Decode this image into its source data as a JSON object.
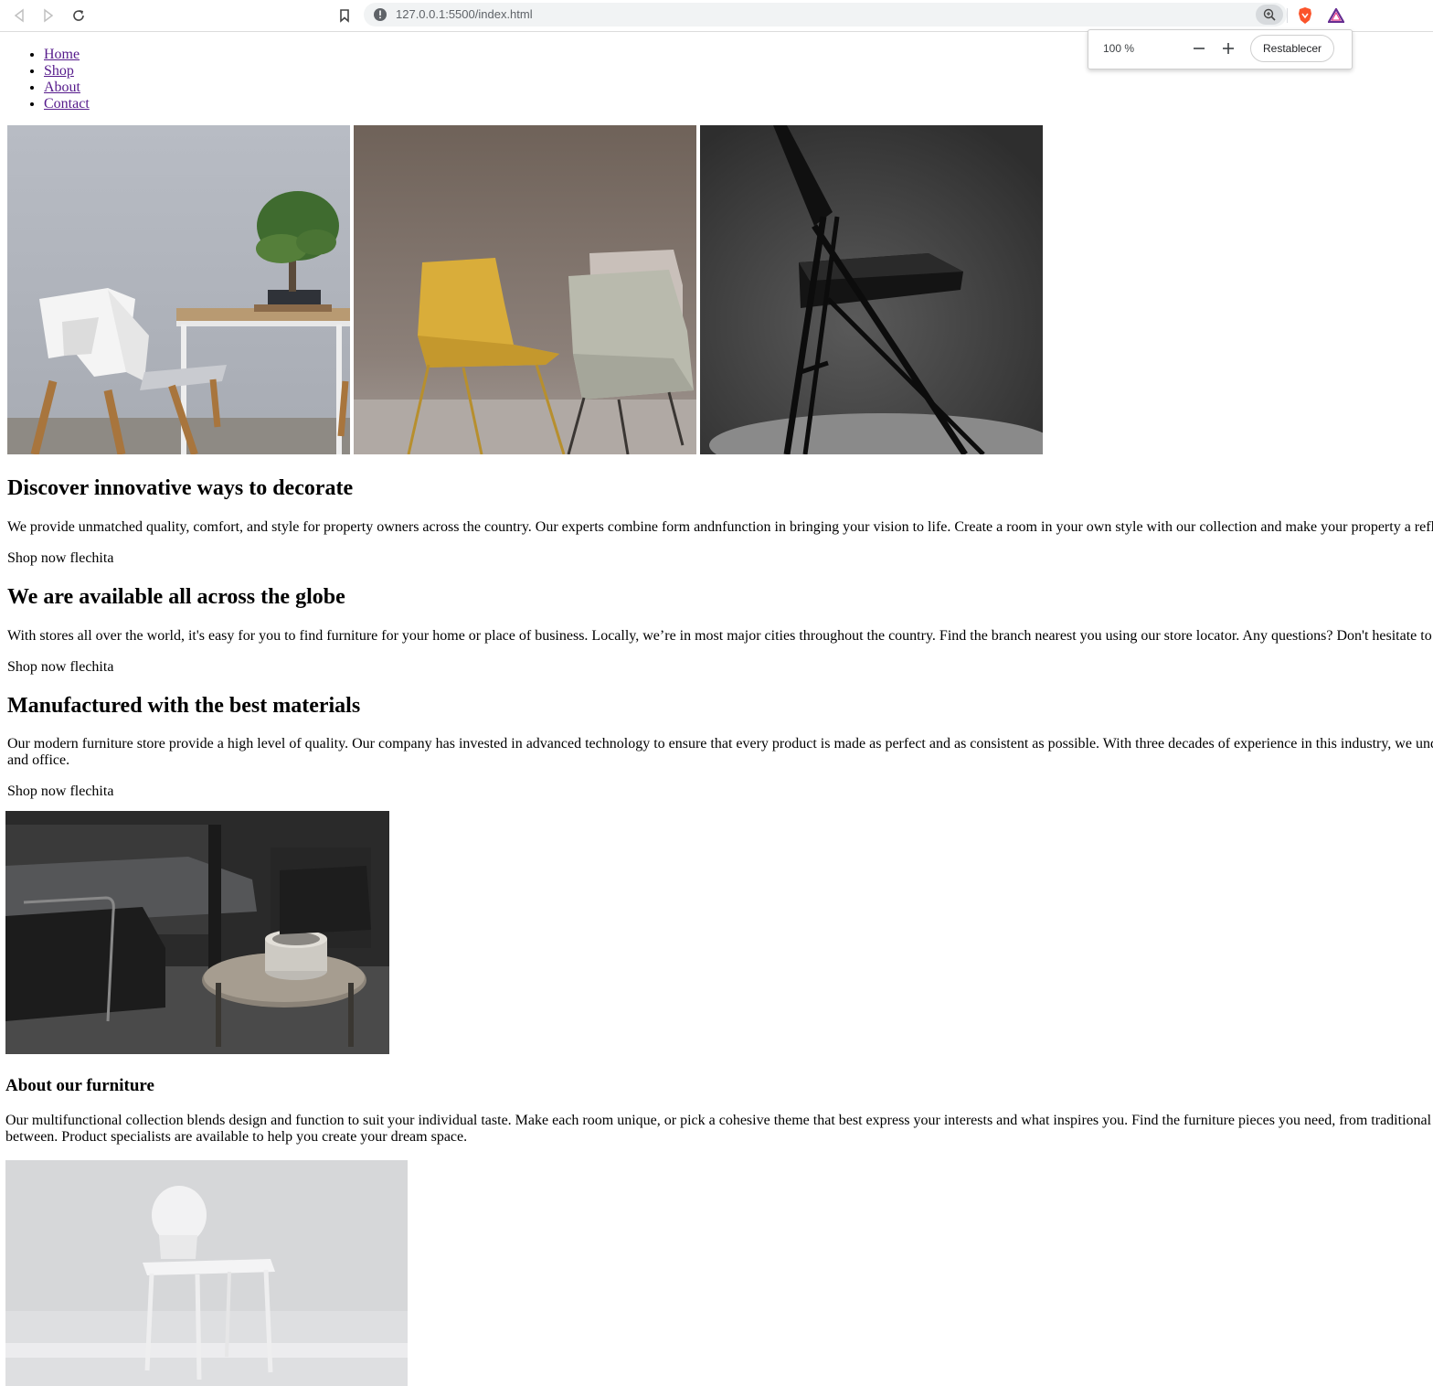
{
  "browser": {
    "url_host": "127.0.0.1:5500",
    "url_path": "/index.html",
    "zoom_level": "100 %",
    "zoom_reset": "Restablecer"
  },
  "nav": [
    "Home",
    "Shop",
    "About",
    "Contact"
  ],
  "sections": [
    {
      "title": "Discover innovative ways to decorate",
      "text": "We provide unmatched quality, comfort, and style for property owners across the country. Our experts combine form andnfunction in bringing your vision to life. Create a room in your own style with our collection and make your property a refl",
      "cta": "Shop now flechita"
    },
    {
      "title": "We are available all across the globe",
      "text": "With stores all over the world, it's easy for you to find furniture for your home or place of business. Locally, we’re in most major cities throughout the country. Find the branch nearest you using our store locator. Any questions? Don't hesitate to",
      "cta": "Shop now flechita"
    },
    {
      "title": "Manufactured with the best materials",
      "text_line1": "Our modern furniture store provide a high level of quality. Our company has invested in advanced technology to ensure that every product is made as perfect and as consistent as possible. With three decades of experience in this industry, we und",
      "text_line2": "and office.",
      "cta": "Shop now flechita"
    }
  ],
  "about": {
    "title": "About our furniture",
    "text_line1": "Our multifunctional collection blends design and function to suit your individual taste. Make each room unique, or pick a cohesive theme that best express your interests and what inspires you. Find the furniture pieces you need, from traditional",
    "text_line2": "between. Product specialists are available to help you create your dream space."
  },
  "images": [
    "white-chair-bonsai-photo",
    "yellow-grey-chairs-photo",
    "black-folding-chair-photo",
    "dark-lounge-chairs-photo",
    "white-chair-light-photo"
  ]
}
